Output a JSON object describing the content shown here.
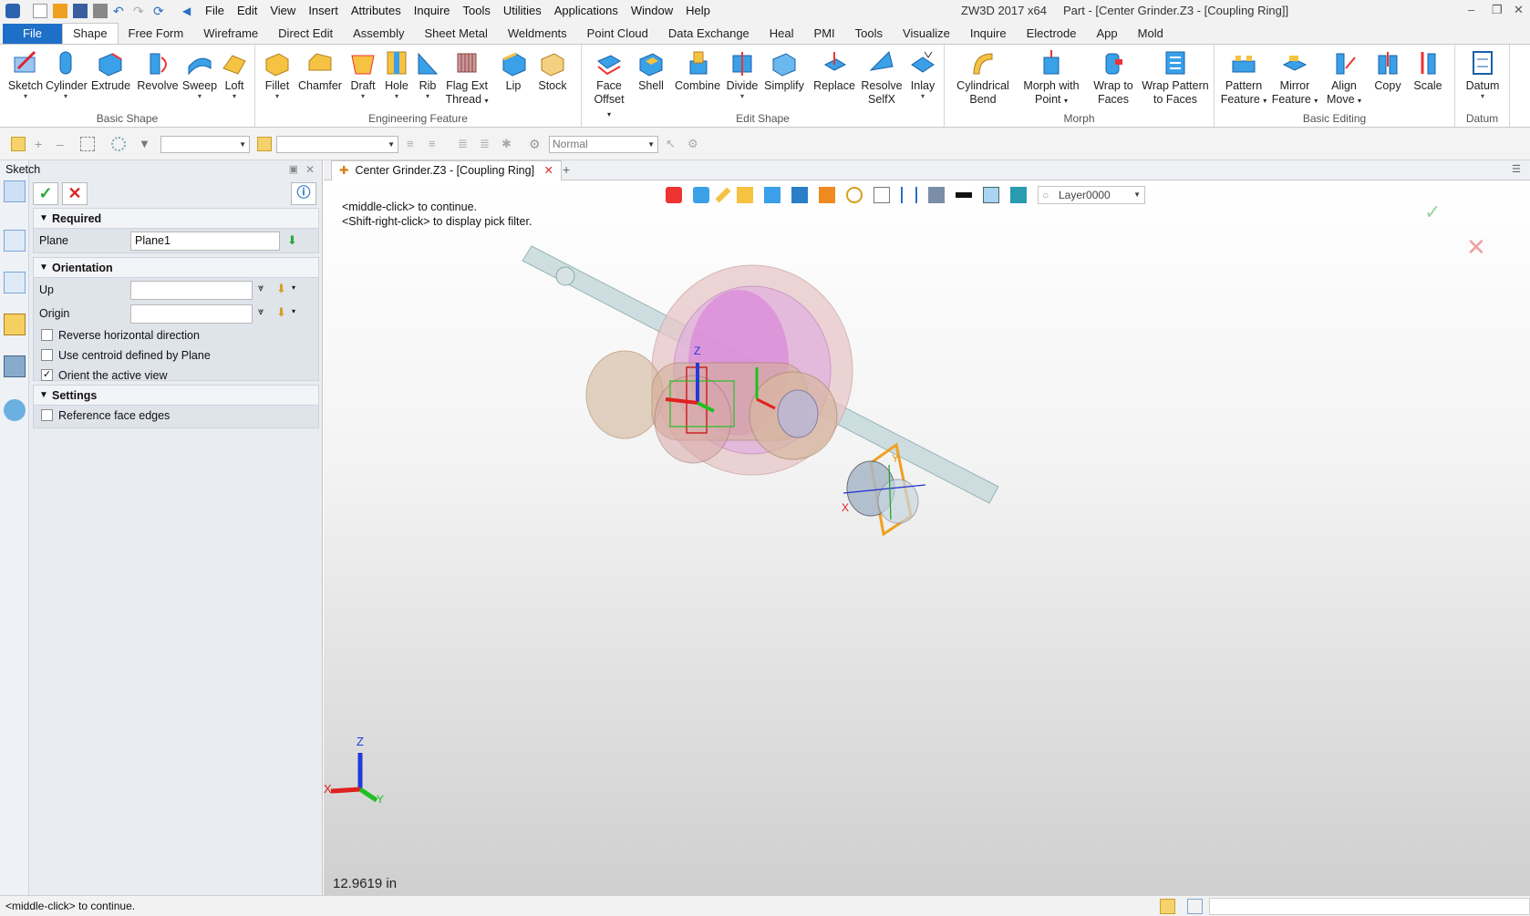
{
  "menu": [
    "File",
    "Edit",
    "View",
    "Insert",
    "Attributes",
    "Inquire",
    "Tools",
    "Utilities",
    "Applications",
    "Window",
    "Help"
  ],
  "title": {
    "app": "ZW3D 2017  x64",
    "doc": "Part - [Center Grinder.Z3 - [Coupling Ring]]"
  },
  "ribbon_tabs": [
    "File",
    "Shape",
    "Free Form",
    "Wireframe",
    "Direct Edit",
    "Assembly",
    "Sheet Metal",
    "Weldments",
    "Point Cloud",
    "Data Exchange",
    "Heal",
    "PMI",
    "Tools",
    "Visualize",
    "Inquire",
    "Electrode",
    "App",
    "Mold"
  ],
  "ribbon": {
    "basic_shape": {
      "label": "Basic Shape",
      "buttons": [
        "Sketch",
        "Cylinder",
        "Extrude",
        "Revolve",
        "Sweep",
        "Loft"
      ]
    },
    "engineering": {
      "label": "Engineering Feature",
      "buttons": [
        "Fillet",
        "Chamfer",
        "Draft",
        "Hole",
        "Rib",
        "Flag Ext",
        "Thread",
        "Lip",
        "Stock"
      ]
    },
    "edit_shape": {
      "label": "Edit Shape",
      "buttons": [
        "Face",
        "Offset",
        "Shell",
        "Combine",
        "Divide",
        "Simplify",
        "Replace",
        "Resolve",
        "SelfX",
        "Inlay"
      ]
    },
    "morph": {
      "label": "Morph",
      "buttons": [
        "Cylindrical",
        "Bend",
        "Morph with",
        "Point",
        "Wrap to",
        "Faces",
        "Wrap Pattern",
        "to Faces"
      ]
    },
    "basic_editing": {
      "label": "Basic Editing",
      "buttons": [
        "Pattern",
        "Feature",
        "Mirror",
        "Feature",
        "Align",
        "Move",
        "Copy",
        "Scale"
      ]
    },
    "datum": {
      "label": "Datum",
      "buttons": [
        "Datum"
      ]
    }
  },
  "toolbar2": {
    "render_mode": "Normal"
  },
  "panel": {
    "title": "Sketch",
    "required": {
      "heading": "Required",
      "plane_label": "Plane",
      "plane_value": "Plane1"
    },
    "orientation": {
      "heading": "Orientation",
      "up_label": "Up",
      "origin_label": "Origin",
      "checks": [
        {
          "label": "Reverse horizontal direction",
          "checked": false
        },
        {
          "label": "Use centroid defined by Plane",
          "checked": false
        },
        {
          "label": "Orient the active view",
          "checked": true
        }
      ]
    },
    "settings": {
      "heading": "Settings",
      "checks": [
        {
          "label": "Reference face edges",
          "checked": false
        }
      ]
    }
  },
  "doc_tab": "Center Grinder.Z3 - [Coupling Ring]",
  "viewport": {
    "layer": "Layer0000",
    "hint1": "<middle-click> to continue.",
    "hint2": "<Shift-right-click> to display pick filter.",
    "measure": "12.9619 in",
    "axis": {
      "x": "X",
      "y": "Y",
      "z": "Z"
    }
  },
  "status": "<middle-click> to continue.",
  "colors": {
    "file_tab": "#1e6fc8",
    "accent_green": "#2aa836",
    "cancel_red": "#d62b2b"
  }
}
